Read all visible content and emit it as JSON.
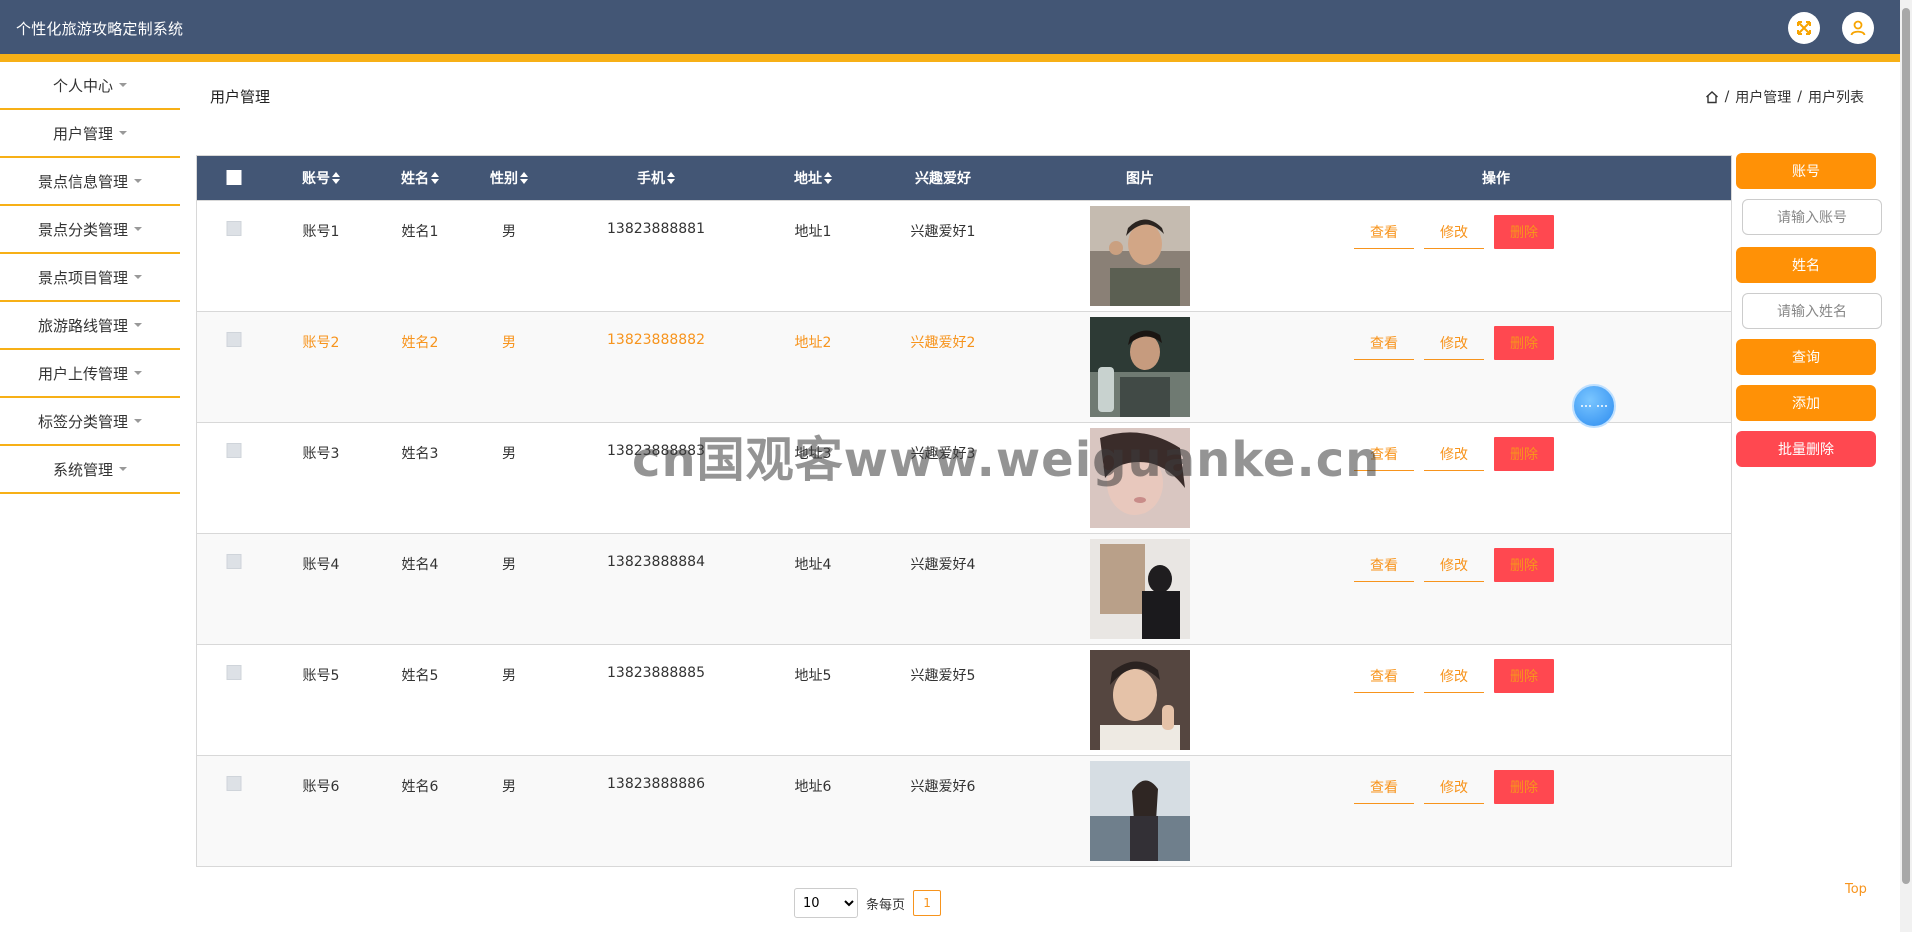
{
  "app": {
    "title": "个性化旅游攻略定制系统"
  },
  "header": {
    "fullscreen_icon": "expand-icon",
    "user_icon": "user-icon"
  },
  "sidebar": {
    "items": [
      {
        "label": "个人中心"
      },
      {
        "label": "用户管理"
      },
      {
        "label": "景点信息管理"
      },
      {
        "label": "景点分类管理"
      },
      {
        "label": "景点项目管理"
      },
      {
        "label": "旅游路线管理"
      },
      {
        "label": "用户上传管理"
      },
      {
        "label": "标签分类管理"
      },
      {
        "label": "系统管理"
      }
    ]
  },
  "page": {
    "title": "用户管理"
  },
  "breadcrumb": {
    "items": [
      "用户管理",
      "用户列表"
    ]
  },
  "table": {
    "headers": {
      "account": "账号",
      "name": "姓名",
      "gender": "性别",
      "phone": "手机",
      "address": "地址",
      "hobby": "兴趣爱好",
      "photo": "图片",
      "actions": "操作"
    },
    "rows": [
      {
        "account": "账号1",
        "name": "姓名1",
        "gender": "男",
        "phone": "13823888881",
        "address": "地址1",
        "hobby": "兴趣爱好1"
      },
      {
        "account": "账号2",
        "name": "姓名2",
        "gender": "男",
        "phone": "13823888882",
        "address": "地址2",
        "hobby": "兴趣爱好2"
      },
      {
        "account": "账号3",
        "name": "姓名3",
        "gender": "男",
        "phone": "13823888883",
        "address": "地址3",
        "hobby": "兴趣爱好3"
      },
      {
        "account": "账号4",
        "name": "姓名4",
        "gender": "男",
        "phone": "13823888884",
        "address": "地址4",
        "hobby": "兴趣爱好4"
      },
      {
        "account": "账号5",
        "name": "姓名5",
        "gender": "男",
        "phone": "13823888885",
        "address": "地址5",
        "hobby": "兴趣爱好5"
      },
      {
        "account": "账号6",
        "name": "姓名6",
        "gender": "男",
        "phone": "13823888886",
        "address": "地址6",
        "hobby": "兴趣爱好6"
      }
    ],
    "actions": {
      "view": "查看",
      "edit": "修改",
      "delete": "删除"
    }
  },
  "pagination": {
    "page_size": "10",
    "per_page_label": "条每页",
    "current_page": "1"
  },
  "search_panel": {
    "account_label": "账号",
    "account_placeholder": "请输入账号",
    "name_label": "姓名",
    "name_placeholder": "请输入姓名",
    "query_button": "查询",
    "add_button": "添加",
    "batch_delete_button": "批量删除"
  },
  "top_link": "Top",
  "watermark": "cn国观客www.weiguanke.cn",
  "colors": {
    "header_bg": "#435675",
    "accent": "#f7b016",
    "orange": "#ff9106",
    "red": "#ff4850"
  }
}
